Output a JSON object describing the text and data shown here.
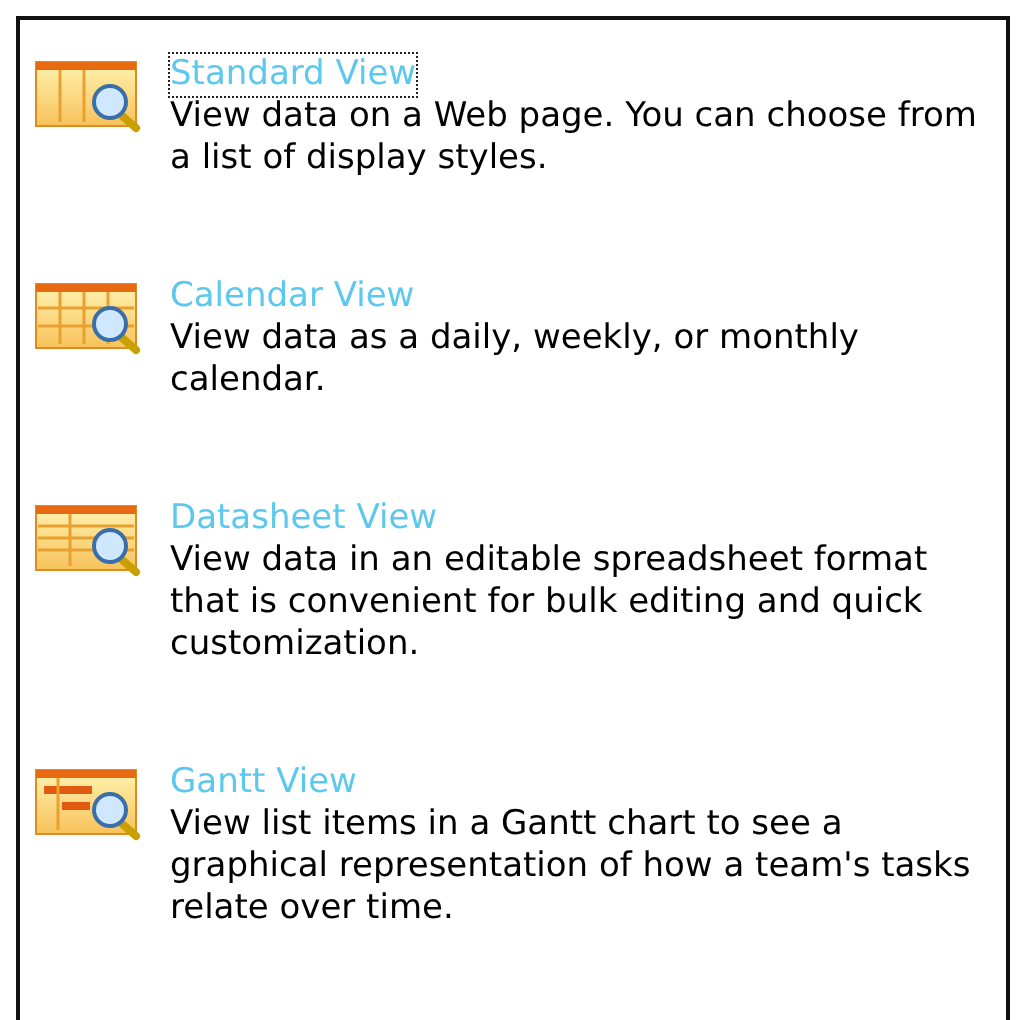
{
  "views": [
    {
      "kind": "standard",
      "title": "Standard View",
      "focused": true,
      "description": "View data on a Web page. You can choose from a list of display styles."
    },
    {
      "kind": "calendar",
      "title": "Calendar View",
      "focused": false,
      "description": "View data as a daily, weekly, or monthly calendar."
    },
    {
      "kind": "datasheet",
      "title": "Datasheet View",
      "focused": false,
      "description": "View data in an editable spreadsheet format that is convenient for bulk editing and quick customization."
    },
    {
      "kind": "gantt",
      "title": "Gantt View",
      "focused": false,
      "description": "View list items in a Gantt chart to see a graphical representation of how a team's tasks relate over time."
    }
  ]
}
